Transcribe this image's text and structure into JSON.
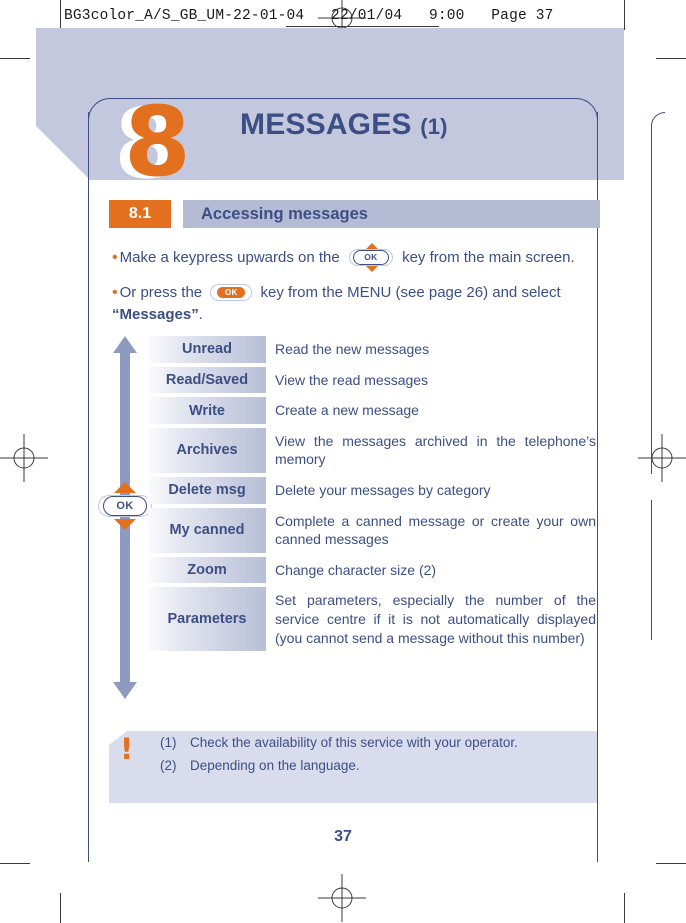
{
  "print_slug": {
    "text": "BG3color_A/S_GB_UM-22-01-04   22/01/04   9:00   Page 37"
  },
  "chapter": {
    "number": "8",
    "title": "MESSAGES",
    "title_suffix": "(1)"
  },
  "section": {
    "number": "8.1",
    "title": "Accessing messages"
  },
  "bullets": {
    "bullet_symbol": "•",
    "one_pre": "Make a keypress upwards on the",
    "one_post": "key from the main screen.",
    "two_pre": "Or press the",
    "two_post": "key from the MENU (see page 26) and select",
    "two_bold": "“Messages”",
    "two_end": ".",
    "ok_label": "OK"
  },
  "menu": {
    "nav_ok_label": "OK",
    "rows": [
      {
        "label": "Unread",
        "desc": "Read the new messages"
      },
      {
        "label": "Read/Saved",
        "desc": "View the read messages"
      },
      {
        "label": "Write",
        "desc": "Create a new message"
      },
      {
        "label": "Archives",
        "desc": "View the messages archived in the telephone’s memory"
      },
      {
        "label": "Delete msg",
        "desc": "Delete your messages by category"
      },
      {
        "label": "My canned",
        "desc": "Complete a canned message or create your own canned messages"
      },
      {
        "label": "Zoom",
        "desc": "Change character size (2)"
      },
      {
        "label": "Parameters",
        "desc": "Set parameters, especially the number of the service centre if it is not automatically displayed (you cannot send a message without this number)"
      }
    ]
  },
  "footnotes": {
    "warning_symbol": "!",
    "items": [
      {
        "num": "(1)",
        "text": "Check the availability of this service with your operator."
      },
      {
        "num": "(2)",
        "text": "Depending on the language."
      }
    ]
  },
  "page_number": "37",
  "colors": {
    "accent_orange": "#e2701e",
    "brand_blue": "#3c4f84",
    "banner_lavender": "#c3c8de",
    "section_bar": "#b4bbd4",
    "nav_bar": "#8e9abf",
    "footnote_bg": "#d9dced"
  }
}
